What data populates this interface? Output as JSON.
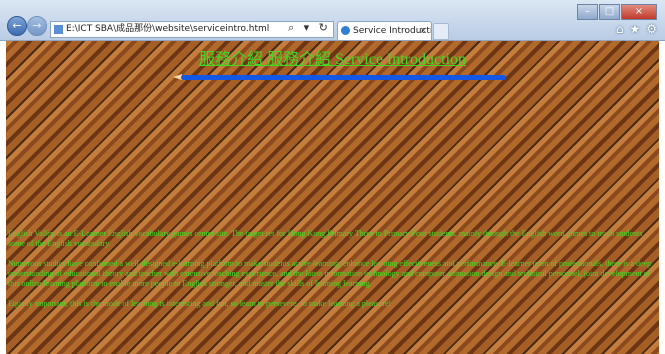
{
  "browser": {
    "address": "E:\\ICT SBA\\成品那份\\website\\serviceintro.html",
    "tab_title": "Service Introduction",
    "tab_close": "×",
    "nav_back": "←",
    "nav_forward": "→",
    "address_tools": "⌕ ▾ ↻ ×",
    "window_buttons": {
      "minimize": "–",
      "maximize": "□",
      "close": "×"
    },
    "toolbar_icons": {
      "home": "⌂",
      "favorites": "★",
      "settings": "⚙"
    }
  },
  "page": {
    "title": "服務介紹 服務介紹 Service Introduction",
    "paragraphs": [
      "English Valley is an E-Learner English vocabulary games center site. The target set for Hong Kong Primary Three to Primary Four students, mainly through the English word games to teach students some of the English vocabulary.",
      "Numerous studies have confirmed a well-designed e-learning platform to make students active learning, enhance learning effectiveness and performance. E-learner team of professionals, there is a deep understanding of educational theory and teacher with extensive teaching experience, and the latest information technology and computer animation design and technical personnel, joint development of this online learning platform to enable more people to English stronger, and master the skills of learning learning.",
      "Equally important, this is the mode of learning is interesting and fun, so learn to persevere, to make learning a pleasure!"
    ]
  },
  "colors": {
    "text": "#3fdc24",
    "progress": "#1357e6"
  }
}
